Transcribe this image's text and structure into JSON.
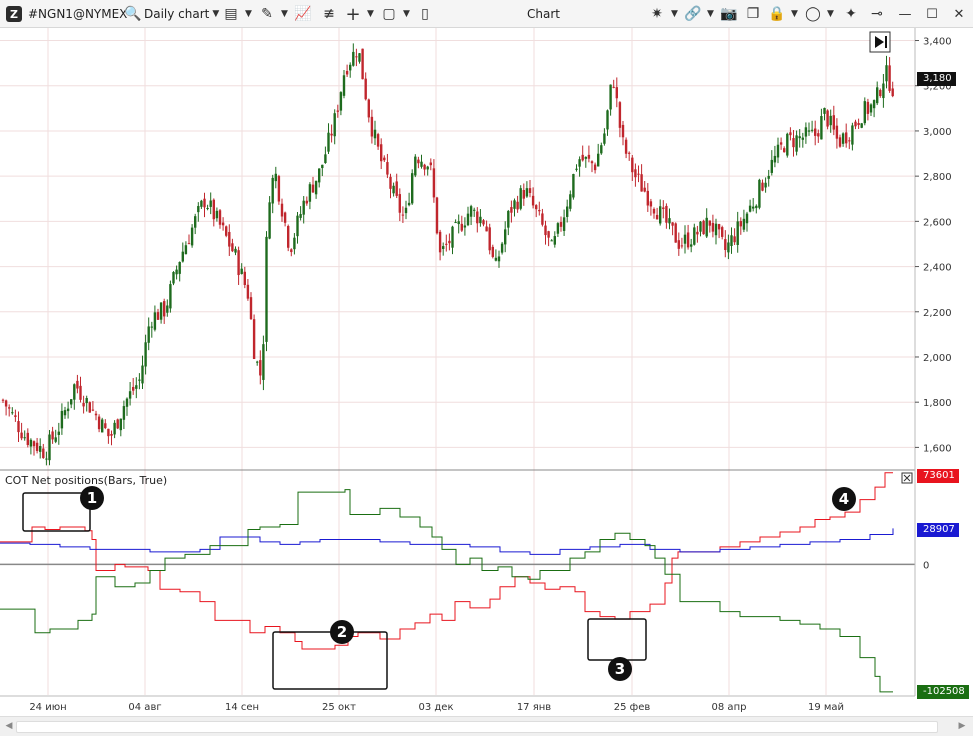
{
  "toolbar": {
    "symbol": "#NGN1@NYMEX",
    "timeframe": "Daily chart",
    "window_title": "Chart"
  },
  "price_axis": {
    "ticks": [
      "3,400",
      "3,200",
      "3,000",
      "2,800",
      "2,600",
      "2,400",
      "2,200",
      "2,000",
      "1,800",
      "1,600"
    ],
    "current_price_label": "3,180"
  },
  "indicator": {
    "title": "COT Net positions(Bars, True)",
    "axis_tick": "0",
    "value_tags": {
      "red": "73601",
      "blue": "28907",
      "green": "-102508"
    }
  },
  "time_axis": {
    "labels": [
      "24 июн",
      "04 авг",
      "14 сен",
      "25 окт",
      "03 дек",
      "17 янв",
      "25 фев",
      "08 апр",
      "19 май"
    ]
  },
  "callouts": [
    "1",
    "2",
    "3",
    "4"
  ],
  "colors": {
    "bull_candle": "#1e6b1e",
    "bear_candle": "#c0262d",
    "cot_red": "#e8141e",
    "cot_green": "#1a6e12",
    "cot_blue": "#1a1ad2",
    "zero_line": "#888888",
    "grid": "#f0dede"
  },
  "chart_data": [
    {
      "type": "candlestick",
      "title": "#NGN1@NYMEX Daily chart",
      "ylim": [
        1500,
        3420
      ],
      "close_path": [
        {
          "x": 0,
          "y": 1830
        },
        {
          "x": 25,
          "y": 1650
        },
        {
          "x": 45,
          "y": 1580
        },
        {
          "x": 60,
          "y": 1700
        },
        {
          "x": 75,
          "y": 1880
        },
        {
          "x": 95,
          "y": 1750
        },
        {
          "x": 110,
          "y": 1640
        },
        {
          "x": 125,
          "y": 1800
        },
        {
          "x": 140,
          "y": 1900
        },
        {
          "x": 150,
          "y": 2170
        },
        {
          "x": 165,
          "y": 2210
        },
        {
          "x": 180,
          "y": 2440
        },
        {
          "x": 195,
          "y": 2600
        },
        {
          "x": 205,
          "y": 2700
        },
        {
          "x": 220,
          "y": 2580
        },
        {
          "x": 235,
          "y": 2450
        },
        {
          "x": 248,
          "y": 2280
        },
        {
          "x": 255,
          "y": 2000
        },
        {
          "x": 262,
          "y": 1900
        },
        {
          "x": 268,
          "y": 2700
        },
        {
          "x": 275,
          "y": 2820
        },
        {
          "x": 290,
          "y": 2480
        },
        {
          "x": 305,
          "y": 2700
        },
        {
          "x": 320,
          "y": 2820
        },
        {
          "x": 335,
          "y": 3050
        },
        {
          "x": 345,
          "y": 3280
        },
        {
          "x": 358,
          "y": 3370
        },
        {
          "x": 370,
          "y": 3050
        },
        {
          "x": 380,
          "y": 2880
        },
        {
          "x": 395,
          "y": 2700
        },
        {
          "x": 405,
          "y": 2600
        },
        {
          "x": 415,
          "y": 2900
        },
        {
          "x": 430,
          "y": 2850
        },
        {
          "x": 440,
          "y": 2450
        },
        {
          "x": 455,
          "y": 2550
        },
        {
          "x": 470,
          "y": 2650
        },
        {
          "x": 485,
          "y": 2600
        },
        {
          "x": 495,
          "y": 2380
        },
        {
          "x": 510,
          "y": 2650
        },
        {
          "x": 525,
          "y": 2740
        },
        {
          "x": 540,
          "y": 2600
        },
        {
          "x": 552,
          "y": 2470
        },
        {
          "x": 565,
          "y": 2650
        },
        {
          "x": 578,
          "y": 2880
        },
        {
          "x": 595,
          "y": 2850
        },
        {
          "x": 605,
          "y": 3000
        },
        {
          "x": 613,
          "y": 3250
        },
        {
          "x": 622,
          "y": 2950
        },
        {
          "x": 635,
          "y": 2800
        },
        {
          "x": 650,
          "y": 2700
        },
        {
          "x": 665,
          "y": 2600
        },
        {
          "x": 680,
          "y": 2500
        },
        {
          "x": 695,
          "y": 2540
        },
        {
          "x": 710,
          "y": 2600
        },
        {
          "x": 725,
          "y": 2470
        },
        {
          "x": 740,
          "y": 2580
        },
        {
          "x": 755,
          "y": 2700
        },
        {
          "x": 770,
          "y": 2840
        },
        {
          "x": 785,
          "y": 2950
        },
        {
          "x": 800,
          "y": 2970
        },
        {
          "x": 815,
          "y": 2980
        },
        {
          "x": 825,
          "y": 3080
        },
        {
          "x": 838,
          "y": 2950
        },
        {
          "x": 850,
          "y": 3000
        },
        {
          "x": 862,
          "y": 3080
        },
        {
          "x": 875,
          "y": 3120
        },
        {
          "x": 885,
          "y": 3260
        },
        {
          "x": 893,
          "y": 3190
        }
      ]
    },
    {
      "type": "line",
      "title": "COT Net positions(Bars, True)",
      "ylim": [
        -105000,
        75000
      ],
      "series": [
        {
          "name": "",
          "color": "red",
          "steps": [
            [
              0,
              18000
            ],
            [
              30,
              18000
            ],
            [
              32,
              30000
            ],
            [
              45,
              28000
            ],
            [
              60,
              30000
            ],
            [
              75,
              30000
            ],
            [
              85,
              27000
            ],
            [
              92,
              20000
            ],
            [
              96,
              -5000
            ],
            [
              115,
              0
            ],
            [
              125,
              -2000
            ],
            [
              148,
              -5000
            ],
            [
              160,
              -20000
            ],
            [
              180,
              -22000
            ],
            [
              200,
              -30000
            ],
            [
              215,
              -45000
            ],
            [
              235,
              -45000
            ],
            [
              250,
              -55000
            ],
            [
              265,
              -50000
            ],
            [
              280,
              -55000
            ],
            [
              295,
              -62000
            ],
            [
              302,
              -68000
            ],
            [
              320,
              -68000
            ],
            [
              335,
              -65000
            ],
            [
              348,
              -58000
            ],
            [
              358,
              -55000
            ],
            [
              380,
              -60000
            ],
            [
              400,
              -52000
            ],
            [
              415,
              -47000
            ],
            [
              430,
              -40000
            ],
            [
              442,
              -45000
            ],
            [
              455,
              -30000
            ],
            [
              470,
              -35000
            ],
            [
              490,
              -28000
            ],
            [
              500,
              -18000
            ],
            [
              515,
              -10000
            ],
            [
              530,
              -15000
            ],
            [
              545,
              -20000
            ],
            [
              560,
              -18000
            ],
            [
              575,
              -22000
            ],
            [
              585,
              -38000
            ],
            [
              600,
              -42000
            ],
            [
              615,
              -44000
            ],
            [
              630,
              -38000
            ],
            [
              650,
              -32000
            ],
            [
              665,
              -15000
            ],
            [
              672,
              5000
            ],
            [
              678,
              10000
            ],
            [
              700,
              10000
            ],
            [
              720,
              14000
            ],
            [
              740,
              18000
            ],
            [
              760,
              22000
            ],
            [
              780,
              26000
            ],
            [
              800,
              30000
            ],
            [
              815,
              36000
            ],
            [
              830,
              38000
            ],
            [
              845,
              42000
            ],
            [
              860,
              52000
            ],
            [
              875,
              62000
            ],
            [
              885,
              73601
            ],
            [
              893,
              73601
            ]
          ]
        },
        {
          "name": "",
          "color": "blue",
          "steps": [
            [
              0,
              17000
            ],
            [
              30,
              16000
            ],
            [
              60,
              14000
            ],
            [
              90,
              12000
            ],
            [
              120,
              12000
            ],
            [
              150,
              10000
            ],
            [
              180,
              10000
            ],
            [
              200,
              12000
            ],
            [
              220,
              22000
            ],
            [
              240,
              22000
            ],
            [
              260,
              18000
            ],
            [
              280,
              16000
            ],
            [
              300,
              18000
            ],
            [
              320,
              20000
            ],
            [
              350,
              20000
            ],
            [
              380,
              18000
            ],
            [
              410,
              16000
            ],
            [
              440,
              16000
            ],
            [
              470,
              14000
            ],
            [
              500,
              10000
            ],
            [
              530,
              8000
            ],
            [
              560,
              12000
            ],
            [
              590,
              14000
            ],
            [
              620,
              16000
            ],
            [
              650,
              12000
            ],
            [
              680,
              10000
            ],
            [
              700,
              10000
            ],
            [
              720,
              12000
            ],
            [
              750,
              14000
            ],
            [
              780,
              16000
            ],
            [
              810,
              18000
            ],
            [
              840,
              20000
            ],
            [
              870,
              24000
            ],
            [
              893,
              28907
            ]
          ]
        },
        {
          "name": "",
          "color": "green",
          "steps": [
            [
              0,
              -36000
            ],
            [
              30,
              -36000
            ],
            [
              35,
              -55000
            ],
            [
              48,
              -55000
            ],
            [
              50,
              -52000
            ],
            [
              78,
              -45000
            ],
            [
              92,
              -40000
            ],
            [
              96,
              -10000
            ],
            [
              115,
              -18000
            ],
            [
              135,
              -15000
            ],
            [
              150,
              -5000
            ],
            [
              165,
              5000
            ],
            [
              185,
              8000
            ],
            [
              210,
              15000
            ],
            [
              248,
              28000
            ],
            [
              260,
              30000
            ],
            [
              280,
              32000
            ],
            [
              298,
              58000
            ],
            [
              335,
              58000
            ],
            [
              345,
              60000
            ],
            [
              350,
              40000
            ],
            [
              380,
              45000
            ],
            [
              400,
              38000
            ],
            [
              420,
              30000
            ],
            [
              432,
              22000
            ],
            [
              442,
              12000
            ],
            [
              456,
              0
            ],
            [
              470,
              5000
            ],
            [
              482,
              -5000
            ],
            [
              498,
              -2000
            ],
            [
              512,
              -10000
            ],
            [
              528,
              -12000
            ],
            [
              540,
              -5000
            ],
            [
              560,
              -5000
            ],
            [
              570,
              5000
            ],
            [
              585,
              10000
            ],
            [
              600,
              20000
            ],
            [
              615,
              25000
            ],
            [
              630,
              20000
            ],
            [
              645,
              15000
            ],
            [
              655,
              5000
            ],
            [
              665,
              -8000
            ],
            [
              680,
              -30000
            ],
            [
              700,
              -30000
            ],
            [
              720,
              -38000
            ],
            [
              740,
              -42000
            ],
            [
              760,
              -42000
            ],
            [
              780,
              -45000
            ],
            [
              800,
              -48000
            ],
            [
              820,
              -52000
            ],
            [
              840,
              -58000
            ],
            [
              860,
              -75000
            ],
            [
              875,
              -90000
            ],
            [
              880,
              -102508
            ],
            [
              893,
              -102508
            ]
          ]
        }
      ]
    }
  ]
}
